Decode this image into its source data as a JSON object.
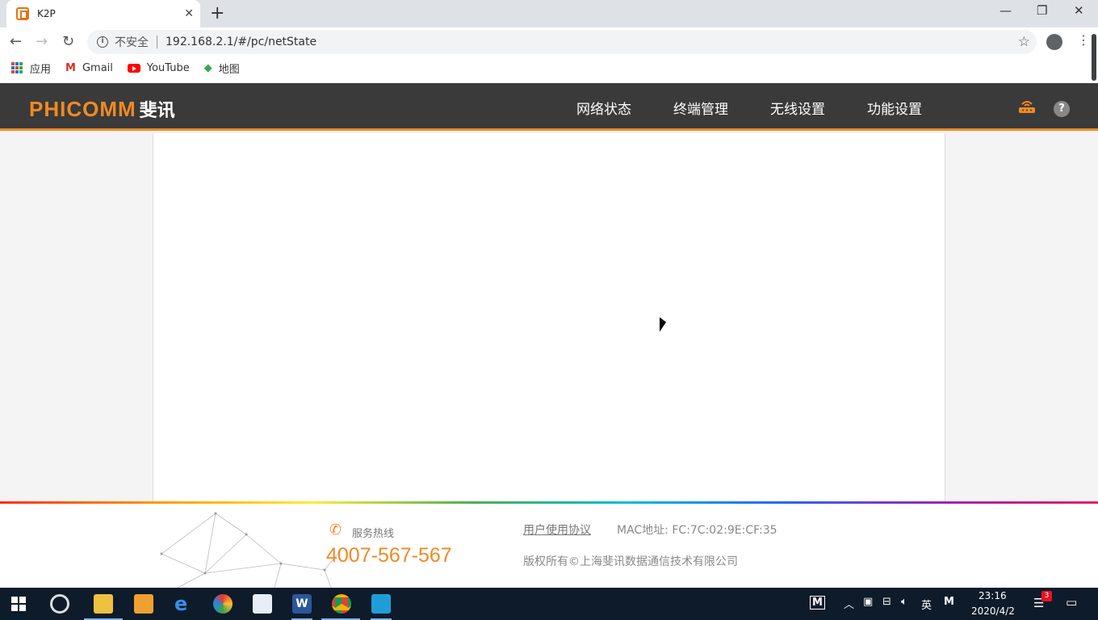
{
  "browser": {
    "tab_title": "K2P",
    "url": "192.168.2.1/#/pc/netState",
    "security_label": "不安全",
    "bookmarks": [
      {
        "label": "应用"
      },
      {
        "label": "Gmail"
      },
      {
        "label": "YouTube"
      },
      {
        "label": "地图"
      }
    ]
  },
  "header": {
    "logo_en": "PHICOMM",
    "logo_cn": "斐讯",
    "nav": [
      {
        "label": "网络状态"
      },
      {
        "label": "终端管理"
      },
      {
        "label": "无线设置"
      },
      {
        "label": "功能设置"
      }
    ],
    "help": "?"
  },
  "footer": {
    "hotline_label": "服务热线",
    "hotline_number": "4007-567-567",
    "agreement_link": "用户使用协议",
    "mac_label": "MAC地址:",
    "mac_value": "FC:7C:02:9E:CF:35",
    "copyright": "版权所有©上海斐讯数据通信技术有限公司"
  },
  "taskbar": {
    "tray_lang": "英",
    "tray_m": "M",
    "time": "23:16",
    "date": "2020/4/2",
    "notification_count": "3"
  },
  "colors": {
    "brand_orange": "#f08a24",
    "header_bg": "#3a3a3a",
    "taskbar_bg": "#0d1b2a"
  }
}
